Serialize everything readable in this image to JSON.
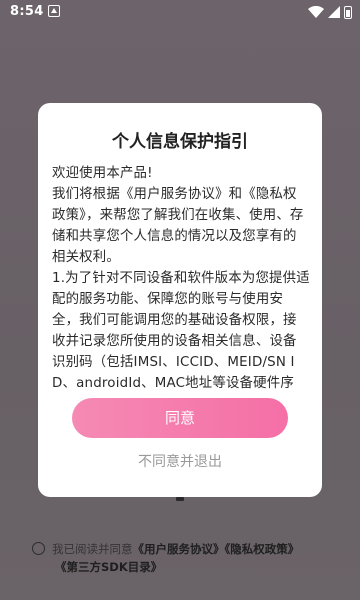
{
  "status_bar": {
    "time": "8:54"
  },
  "dialog": {
    "title": "个人信息保护指引",
    "body": "欢迎使用本产品!\n我们将根据《用户服务协议》和《隐私权政策》，来帮您了解我们在收集、使用、存储和共享您个人信息的情况以及您享有的相关权利。\n1.为了针对不同设备和软件版本为您提供适配的服务功能、保障您的账号与使用安全，我们可能调用您的基础设备权限，接收并记录您所使用的设备相关信息、设备识别码（包括IMSI、ICCID、MEID/SN ID、androidId、MAC地址等设备硬件序",
    "agree_label": "同意",
    "disagree_label": "不同意并退出"
  },
  "footer": {
    "prefix": "我已阅读并同意",
    "link_service": "《用户服务协议》",
    "link_privacy": "《隐私权政策》",
    "link_sdk": "《第三方SDK目录》"
  }
}
